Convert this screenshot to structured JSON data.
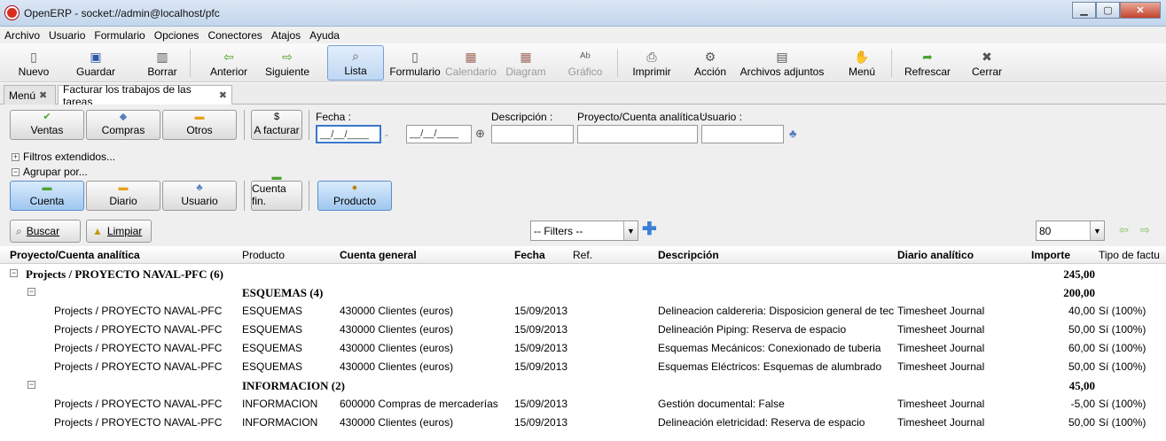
{
  "window": {
    "title": "OpenERP - socket://admin@localhost/pfc"
  },
  "menu": [
    "Archivo",
    "Usuario",
    "Formulario",
    "Opciones",
    "Conectores",
    "Atajos",
    "Ayuda"
  ],
  "toolbar": {
    "nuevo": "Nuevo",
    "guardar": "Guardar",
    "borrar": "Borrar",
    "anterior": "Anterior",
    "siguiente": "Siguiente",
    "lista": "Lista",
    "formulario": "Formulario",
    "calendario": "Calendario",
    "diagram": "Diagram",
    "grafico": "Gráfico",
    "imprimir": "Imprimir",
    "accion": "Acción",
    "adjuntos": "Archivos adjuntos",
    "menu": "Menú",
    "refrescar": "Refrescar",
    "cerrar": "Cerrar"
  },
  "tabs": {
    "menu": "Menú",
    "active": "Facturar los trabajos de las tareas"
  },
  "filters": {
    "ventas": "Ventas",
    "compras": "Compras",
    "otros": "Otros",
    "a_facturar": "A facturar",
    "fecha_label": "Fecha :",
    "descripcion_label": "Descripción :",
    "proyecto_label": "Proyecto/Cuenta analítica :",
    "usuario_label": "Usuario :",
    "date_mask": "__/__/____",
    "date_sep": "-",
    "extendidos": "Filtros extendidos...",
    "agrupar": "Agrupar por...",
    "cuenta": "Cuenta",
    "diario": "Diario",
    "usuario": "Usuario",
    "cuenta_fin": "Cuenta fin.",
    "producto": "Producto",
    "buscar": "Buscar",
    "limpiar": "Limpiar",
    "filters_combo": "-- Filters --",
    "limit": "80"
  },
  "columns": {
    "proyecto": "Proyecto/Cuenta analítica",
    "producto": "Producto",
    "cuenta": "Cuenta general",
    "fecha": "Fecha",
    "ref": "Ref.",
    "descripcion": "Descripción",
    "diario": "Diario analítico",
    "importe": "Importe",
    "tipo": "Tipo de factu"
  },
  "rows": {
    "g0": {
      "label": "Projects / PROYECTO NAVAL-PFC (6)",
      "importe": "245,00"
    },
    "g1": {
      "label": "ESQUEMAS (4)",
      "importe": "200,00"
    },
    "r1": {
      "proyecto": "Projects / PROYECTO NAVAL-PFC",
      "producto": "ESQUEMAS",
      "cuenta": "430000 Clientes (euros)",
      "fecha": "15/09/2013",
      "descripcion": "Delineacion caldereria: Disposicion general de tecles",
      "diario": "Timesheet Journal",
      "importe": "40,00",
      "tipo": "Sí (100%)"
    },
    "r2": {
      "proyecto": "Projects / PROYECTO NAVAL-PFC",
      "producto": "ESQUEMAS",
      "cuenta": "430000 Clientes (euros)",
      "fecha": "15/09/2013",
      "descripcion": "Delineación Piping: Reserva de espacio",
      "diario": "Timesheet Journal",
      "importe": "50,00",
      "tipo": "Sí (100%)"
    },
    "r3": {
      "proyecto": "Projects / PROYECTO NAVAL-PFC",
      "producto": "ESQUEMAS",
      "cuenta": "430000 Clientes (euros)",
      "fecha": "15/09/2013",
      "descripcion": "Esquemas Mecánicos: Conexionado de tuberia",
      "diario": "Timesheet Journal",
      "importe": "60,00",
      "tipo": "Sí (100%)"
    },
    "r4": {
      "proyecto": "Projects / PROYECTO NAVAL-PFC",
      "producto": "ESQUEMAS",
      "cuenta": "430000 Clientes (euros)",
      "fecha": "15/09/2013",
      "descripcion": "Esquemas Eléctricos: Esquemas de alumbrado",
      "diario": "Timesheet Journal",
      "importe": "50,00",
      "tipo": "Sí (100%)"
    },
    "g2": {
      "label": "INFORMACION (2)",
      "importe": "45,00"
    },
    "r5": {
      "proyecto": "Projects / PROYECTO NAVAL-PFC",
      "producto": "INFORMACION",
      "cuenta": "600000 Compras de mercaderías",
      "fecha": "15/09/2013",
      "descripcion": "Gestión documental: False",
      "diario": "Timesheet Journal",
      "importe": "-5,00",
      "tipo": "Sí (100%)"
    },
    "r6": {
      "proyecto": "Projects / PROYECTO NAVAL-PFC",
      "producto": "INFORMACION",
      "cuenta": "430000 Clientes (euros)",
      "fecha": "15/09/2013",
      "descripcion": "Delineación eletricidad: Reserva de espacio",
      "diario": "Timesheet Journal",
      "importe": "50,00",
      "tipo": "Sí (100%)"
    }
  }
}
